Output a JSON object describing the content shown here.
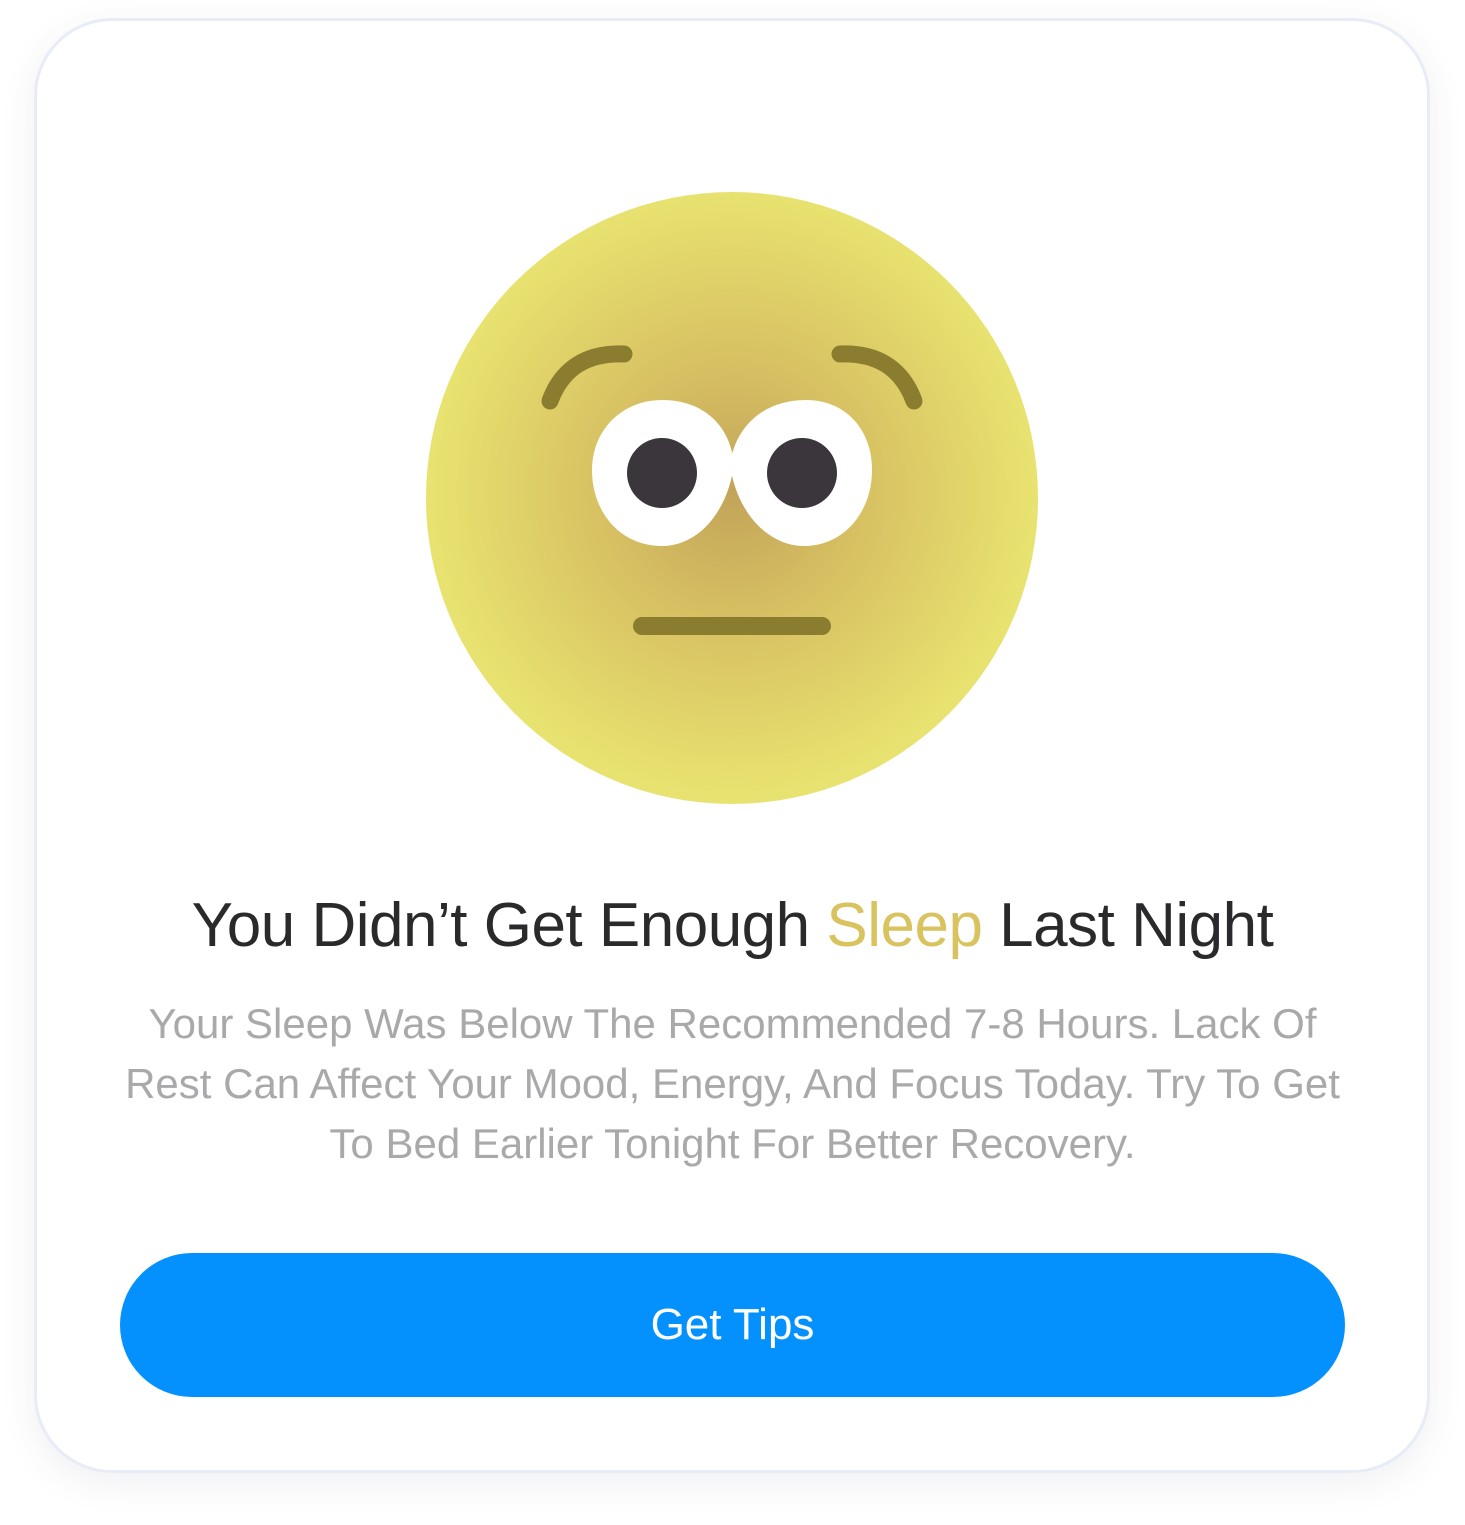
{
  "card": {
    "headline_before": "You Didn’t Get Enough ",
    "headline_highlight": "Sleep",
    "headline_after": " Last Night",
    "message": "Your Sleep Was Below The Recommended 7-8 Hours. Lack Of Rest Can Affect Your Mood, Energy, And Focus Today. Try To Get To Bed Earlier Tonight For Better Recovery.",
    "button_label": "Get Tips"
  },
  "colors": {
    "accent": "#d8c35f",
    "button": "#0591fd",
    "headline": "#2a2a2c",
    "message": "#a9a9ab",
    "face_outer": "#e8e370",
    "face_inner": "#c2a459"
  },
  "icons": {
    "illustration": "neutral-face-emoji-icon"
  }
}
